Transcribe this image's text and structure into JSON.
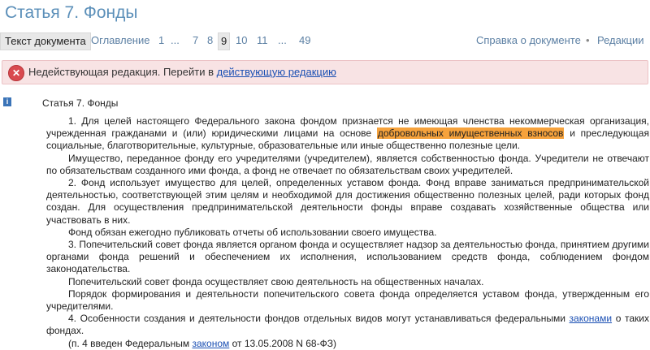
{
  "page": {
    "title": "Статья 7. Фонды"
  },
  "tabs": {
    "document_text": "Текст документа",
    "contents": "Оглавление",
    "pages": [
      "1",
      "...",
      "7",
      "8",
      "9",
      "10",
      "11",
      "...",
      "49"
    ],
    "current_page": "9",
    "help_link": "Справка о документе",
    "separator": "•",
    "editions_link": "Редакции"
  },
  "banner": {
    "text": "Недействующая редакция. Перейти в ",
    "link": "действующую редакцию",
    "icon": "error-x-icon"
  },
  "document": {
    "info_icon": "info-icon",
    "heading": "Статья 7. Фонды",
    "p1_before": "1. Для целей настоящего Федерального закона фондом признается не имеющая членства некоммерческая организация, учрежденная гражданами и (или) юридическими лицами на основе ",
    "p1_highlight": "добровольных имущественных взносов",
    "p1_after": " и преследующая социальные, благотворительные, культурные, образовательные или иные общественно полезные цели.",
    "p2": "Имущество, переданное фонду его учредителями (учредителем), является собственностью фонда. Учредители не отвечают по обязательствам созданного ими фонда, а фонд не отвечает по обязательствам своих учредителей.",
    "p3": "2. Фонд использует имущество для целей, определенных уставом фонда. Фонд вправе заниматься предпринимательской деятельностью, соответствующей этим целям и необходимой для достижения общественно полезных целей, ради которых фонд создан. Для осуществления предпринимательской деятельности фонды вправе создавать хозяйственные общества или участвовать в них.",
    "p4": "Фонд обязан ежегодно публиковать отчеты об использовании своего имущества.",
    "p5": "3. Попечительский совет фонда является органом фонда и осуществляет надзор за деятельностью фонда, принятием другими органами фонда решений и обеспечением их исполнения, использованием средств фонда, соблюдением фондом законодательства.",
    "p6": "Попечительский совет фонда осуществляет свою деятельность на общественных началах.",
    "p7": "Порядок формирования и деятельности попечительского совета фонда определяется уставом фонда, утвержденным его учредителями.",
    "p8_before": "4. Особенности создания и деятельности фондов отдельных видов могут устанавливаться федеральными ",
    "p8_link": "законами",
    "p8_after": " о таких фондах.",
    "p9_before": "(п. 4 введен Федеральным ",
    "p9_link": "законом",
    "p9_after": " от 13.05.2008 N 68-ФЗ)"
  }
}
